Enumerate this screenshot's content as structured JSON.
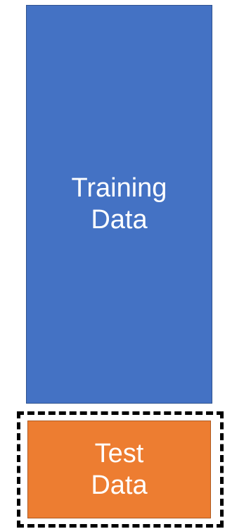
{
  "blocks": {
    "training": {
      "label": "Training\nData",
      "fill": "#4472c4"
    },
    "test": {
      "label": "Test\nData",
      "fill": "#ed7d31"
    }
  },
  "selection": {
    "style": "dashed",
    "color": "#000000"
  }
}
